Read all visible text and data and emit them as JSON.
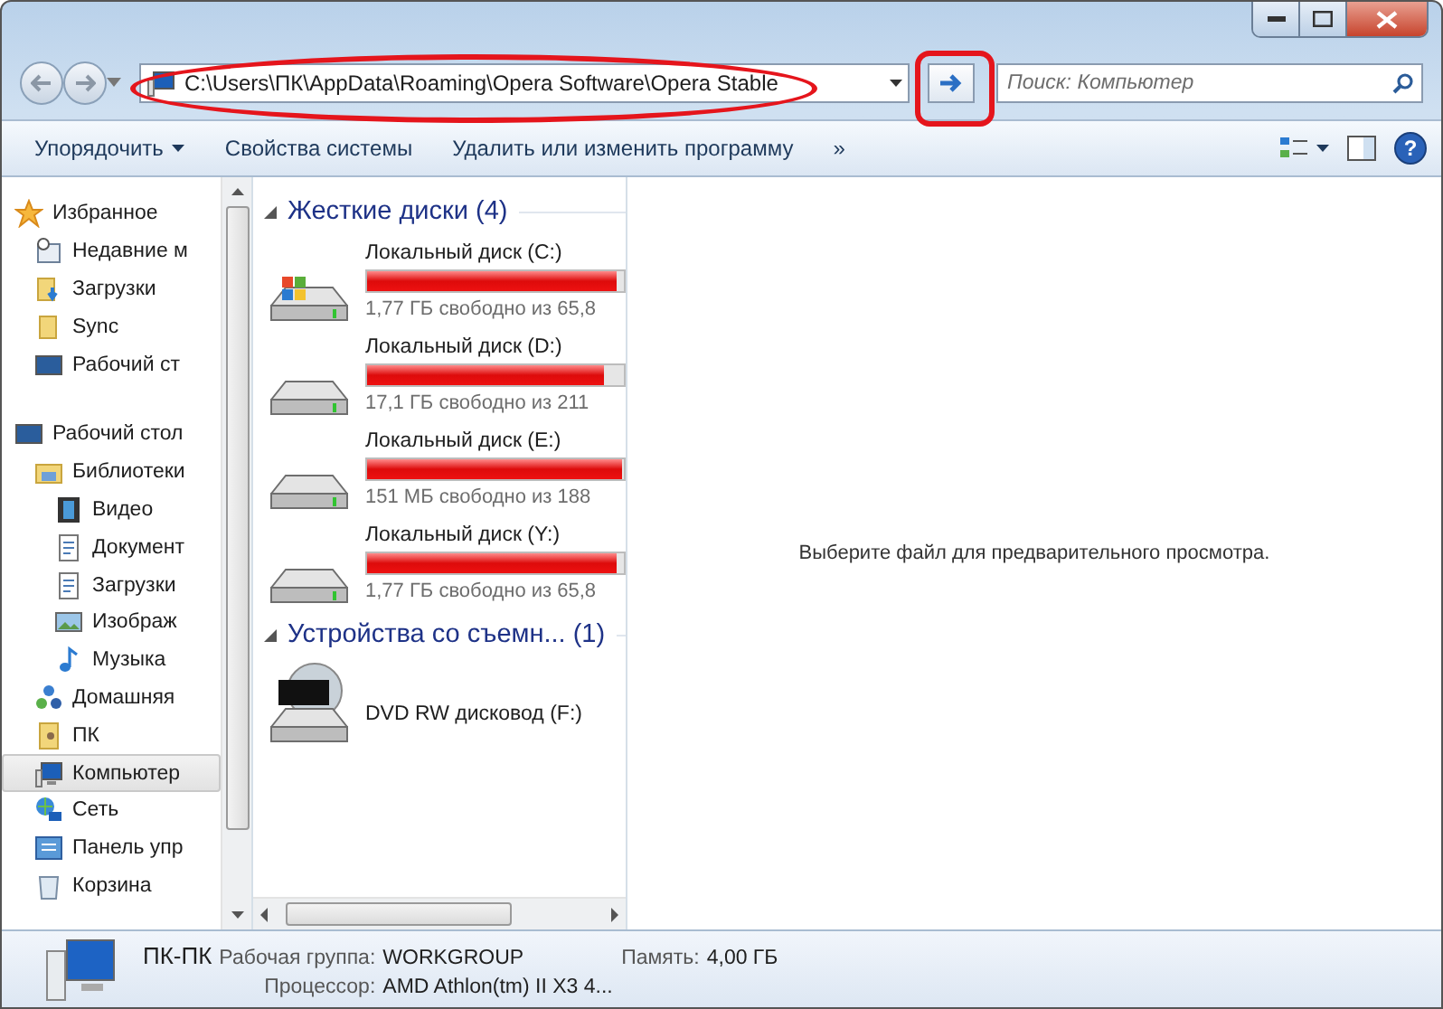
{
  "address_bar": {
    "path": "C:\\Users\\ПК\\AppData\\Roaming\\Opera Software\\Opera Stable"
  },
  "search": {
    "placeholder": "Поиск: Компьютер"
  },
  "toolbar": {
    "items": [
      {
        "label": "Упорядочить",
        "kind": "menu"
      },
      {
        "label": "Свойства системы",
        "kind": "plain"
      },
      {
        "label": "Удалить или изменить программу",
        "kind": "plain"
      },
      {
        "label": "»",
        "kind": "plain"
      }
    ],
    "help": "?"
  },
  "navigation": {
    "groups": [
      {
        "label": "Избранное",
        "kind": "star",
        "selected": false,
        "children": [
          {
            "label": "Недавние м",
            "kind": "recent",
            "selected": false
          },
          {
            "label": "Загрузки",
            "kind": "downloads",
            "selected": false
          },
          {
            "label": "Sync",
            "kind": "folder",
            "selected": false
          },
          {
            "label": "Рабочий ст",
            "kind": "desktop",
            "selected": false
          }
        ]
      },
      {
        "label": "Рабочий стол",
        "kind": "desktop",
        "selected": false,
        "children": [
          {
            "label": "Библиотеки",
            "kind": "library",
            "selected": false,
            "children": [
              {
                "label": "Видео",
                "kind": "video",
                "selected": false
              },
              {
                "label": "Документ",
                "kind": "document",
                "selected": false
              },
              {
                "label": "Загрузки",
                "kind": "document",
                "selected": false
              },
              {
                "label": "Изображ",
                "kind": "picture",
                "selected": false
              },
              {
                "label": "Музыка",
                "kind": "music",
                "selected": false
              }
            ]
          },
          {
            "label": "Домашняя",
            "kind": "homegroup",
            "selected": false
          },
          {
            "label": "ПК",
            "kind": "user",
            "selected": false
          },
          {
            "label": "Компьютер",
            "kind": "computer",
            "selected": true
          },
          {
            "label": "Сеть",
            "kind": "network",
            "selected": false
          },
          {
            "label": "Панель упр",
            "kind": "control",
            "selected": false
          },
          {
            "label": "Корзина",
            "kind": "trash",
            "selected": false
          }
        ]
      }
    ]
  },
  "content": {
    "sections": [
      {
        "title": "Жесткие диски (4)",
        "items": [
          {
            "name": "Локальный диск (C:)",
            "kind": "system-drive",
            "level": 0.97,
            "free": "1,77 ГБ свободно из 65,8"
          },
          {
            "name": "Локальный диск (D:)",
            "kind": "drive",
            "level": 0.92,
            "free": "17,1 ГБ свободно из 211"
          },
          {
            "name": "Локальный диск (E:)",
            "kind": "drive",
            "level": 0.99,
            "free": "151 МБ свободно из 188"
          },
          {
            "name": "Локальный диск (Y:)",
            "kind": "drive",
            "level": 0.97,
            "free": "1,77 ГБ свободно из 65,8"
          }
        ]
      },
      {
        "title": "Устройства со съемн... (1)",
        "items": [
          {
            "name": "DVD RW дисковод (F:)",
            "kind": "dvd"
          }
        ]
      }
    ]
  },
  "preview": {
    "message": "Выберите файл для предварительного просмотра."
  },
  "details": {
    "name": "ПК-ПК",
    "fields": [
      {
        "label": "Рабочая группа:",
        "value": "WORKGROUP"
      },
      {
        "label": "Память:",
        "value": "4,00 ГБ"
      },
      {
        "label": "Процессор:",
        "value": "AMD Athlon(tm) II X3 4..."
      }
    ]
  }
}
